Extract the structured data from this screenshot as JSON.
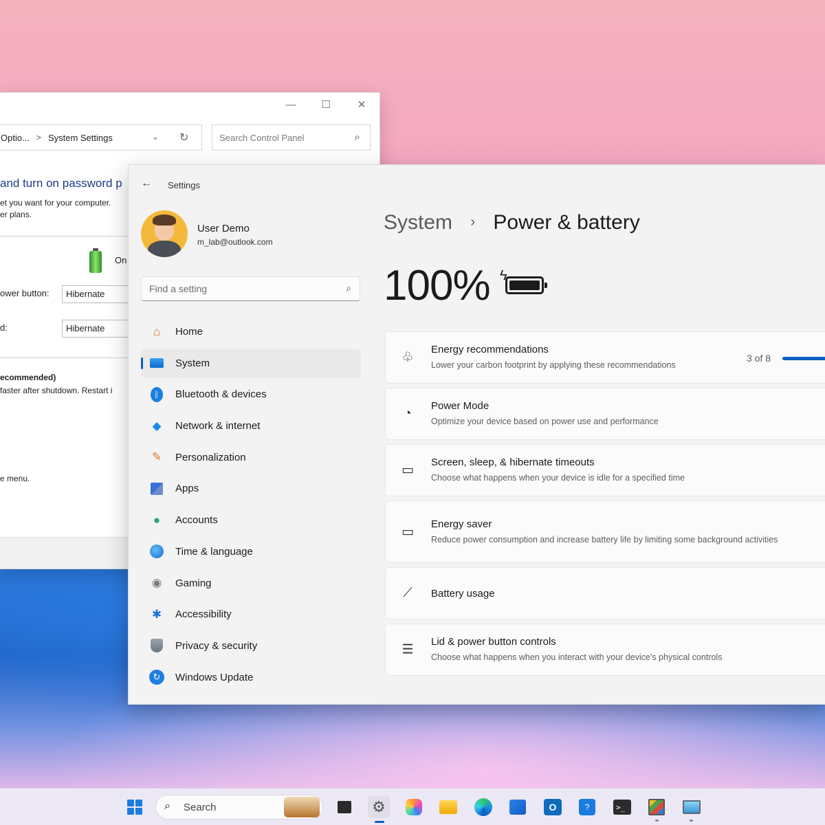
{
  "control_panel": {
    "breadcrumb_part1": "Optio...",
    "breadcrumb_sep": ">",
    "breadcrumb_part2": "System Settings",
    "search_placeholder": "Search Control Panel",
    "heading": "and turn on password p",
    "desc_line1": "et you want for your computer.",
    "desc_line2": "er plans.",
    "on_label": "On",
    "power_button_label": "ower button:",
    "power_button_value": "Hibernate",
    "sleep_label": "d:",
    "sleep_value": "Hibernate",
    "recommended": "ecommended)",
    "faster": "faster after shutdown. Restart i",
    "menu": "e menu."
  },
  "settings": {
    "title": "Settings",
    "user_name": "User Demo",
    "user_email": "m_lab@outlook.com",
    "find_placeholder": "Find a setting",
    "nav": [
      {
        "label": "Home",
        "icon": "home-icon"
      },
      {
        "label": "System",
        "icon": "system-icon",
        "active": true
      },
      {
        "label": "Bluetooth & devices",
        "icon": "bluetooth-icon"
      },
      {
        "label": "Network & internet",
        "icon": "wifi-icon"
      },
      {
        "label": "Personalization",
        "icon": "brush-icon"
      },
      {
        "label": "Apps",
        "icon": "apps-icon"
      },
      {
        "label": "Accounts",
        "icon": "person-icon"
      },
      {
        "label": "Time & language",
        "icon": "globe-clock-icon"
      },
      {
        "label": "Gaming",
        "icon": "gamepad-icon"
      },
      {
        "label": "Accessibility",
        "icon": "accessibility-icon"
      },
      {
        "label": "Privacy & security",
        "icon": "shield-icon"
      },
      {
        "label": "Windows Update",
        "icon": "update-icon"
      }
    ],
    "breadcrumb_parent": "System",
    "breadcrumb_sep": "›",
    "page_title": "Power & battery",
    "battery_percent": "100%",
    "cards": [
      {
        "title": "Energy recommendations",
        "subtitle": "Lower your carbon footprint by applying these recommendations",
        "icon": "leaf-icon",
        "count": "3 of 8"
      },
      {
        "title": "Power Mode",
        "subtitle": "Optimize your device based on power use and performance",
        "icon": "gauge-icon"
      },
      {
        "title": "Screen, sleep, & hibernate timeouts",
        "subtitle": "Choose what happens when your device is idle for a specified time",
        "icon": "screen-sleep-icon"
      },
      {
        "title": "Energy saver",
        "subtitle": "Reduce power consumption and increase battery life by limiting some background activities",
        "icon": "energy-saver-icon"
      },
      {
        "title": "Battery usage",
        "subtitle": "",
        "icon": "chart-icon"
      },
      {
        "title": "Lid & power button controls",
        "subtitle": "Choose what happens when you interact with your device's physical controls",
        "icon": "list-icon"
      }
    ]
  },
  "taskbar": {
    "search_label": "Search"
  },
  "colors": {
    "accent": "#0a5fc2",
    "settings_bg": "#f3f3f3",
    "card_bg": "#fbfbfb"
  }
}
